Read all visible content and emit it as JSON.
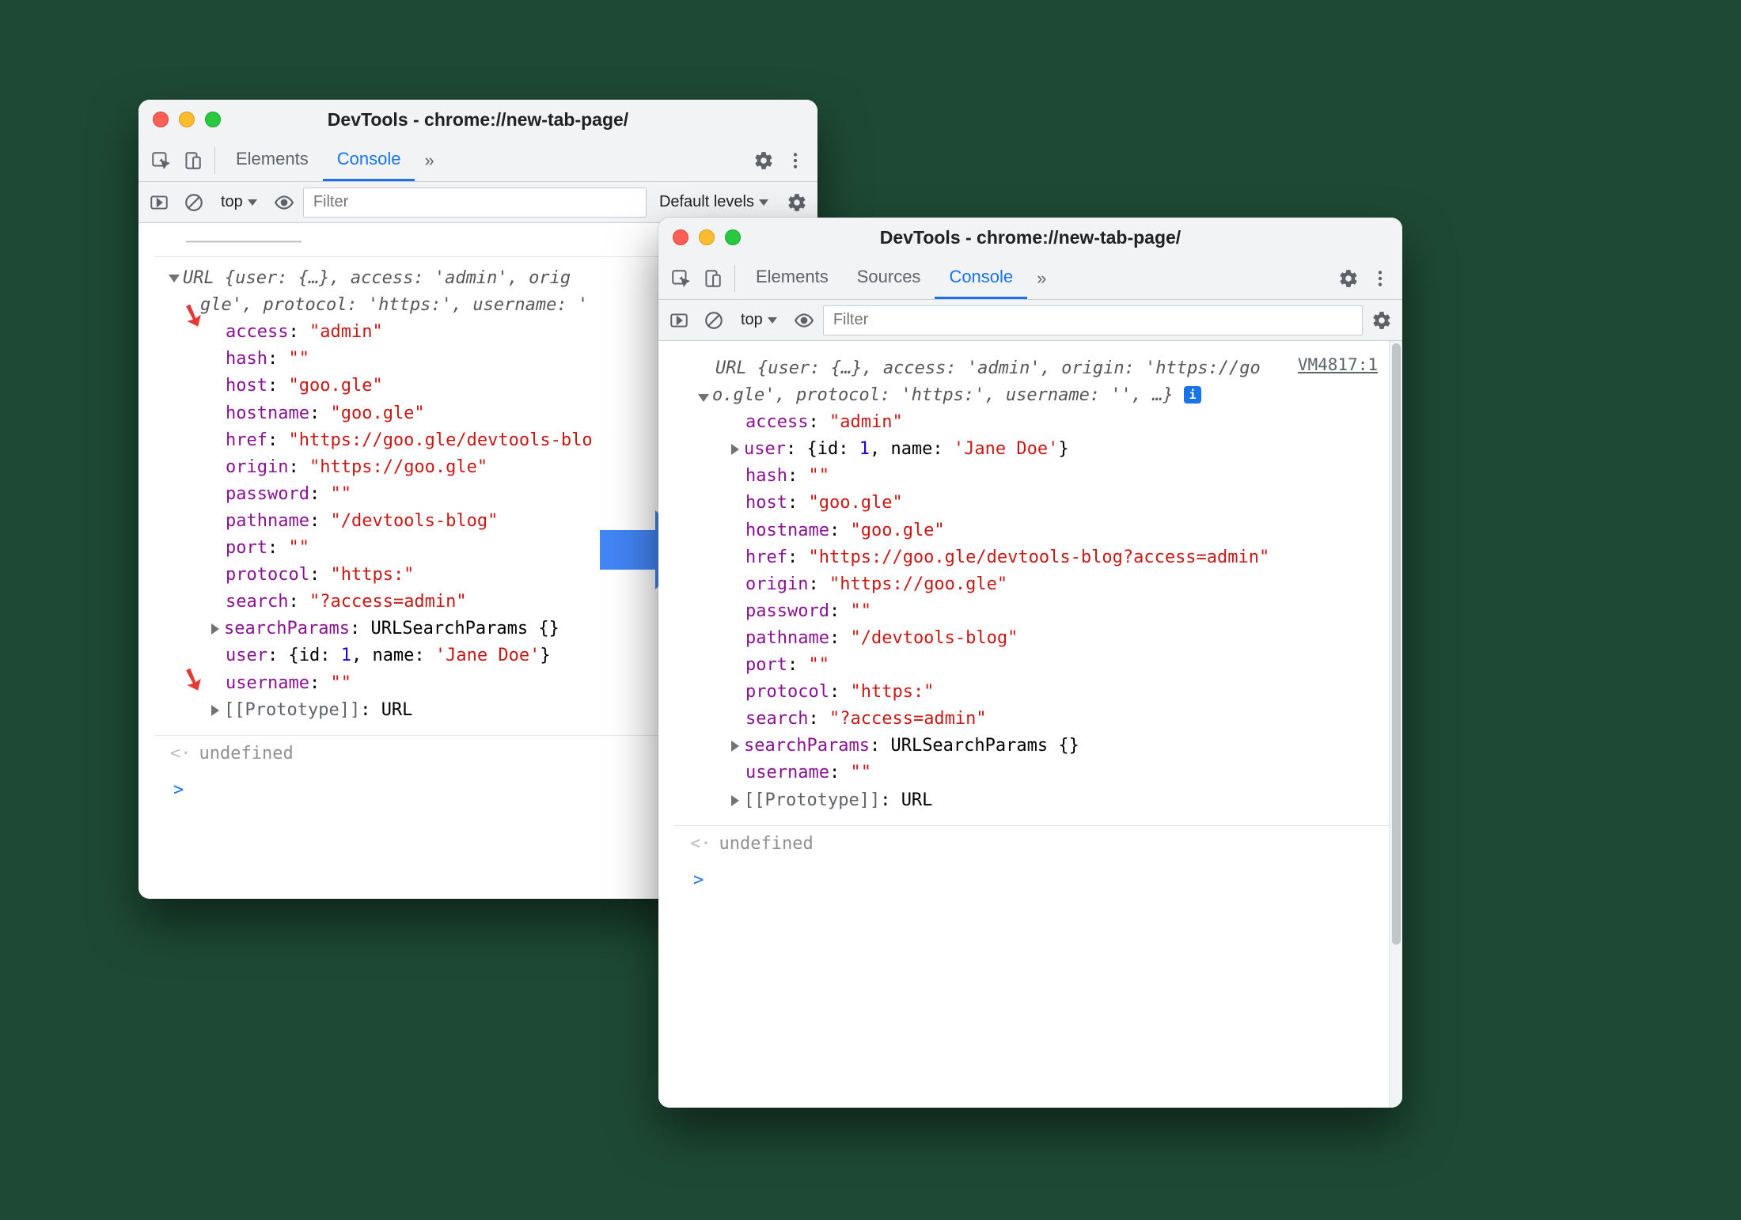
{
  "win1": {
    "title": "DevTools - chrome://new-tab-page/",
    "tabs": {
      "elements": "Elements",
      "console": "Console"
    },
    "subbar": {
      "context": "top",
      "filter_placeholder": "Filter",
      "levels": "Default levels"
    },
    "preview_line1": "URL {user: {…}, access: 'admin', orig",
    "preview_line2": "gle', protocol: 'https:', username: '",
    "props": {
      "access": {
        "k": "access",
        "v": "\"admin\""
      },
      "hash": {
        "k": "hash",
        "v": "\"\""
      },
      "host": {
        "k": "host",
        "v": "\"goo.gle\""
      },
      "hostname": {
        "k": "hostname",
        "v": "\"goo.gle\""
      },
      "href": {
        "k": "href",
        "v": "\"https://goo.gle/devtools-blo"
      },
      "origin": {
        "k": "origin",
        "v": "\"https://goo.gle\""
      },
      "password": {
        "k": "password",
        "v": "\"\""
      },
      "pathname": {
        "k": "pathname",
        "v": "\"/devtools-blog\""
      },
      "port": {
        "k": "port",
        "v": "\"\""
      },
      "protocol": {
        "k": "protocol",
        "v": "\"https:\""
      },
      "search": {
        "k": "search",
        "v": "\"?access=admin\""
      },
      "searchParams": {
        "k": "searchParams",
        "v": "URLSearchParams {}"
      },
      "user_line": "user: {id: 1, name: 'Jane Doe'}",
      "user_id": "1",
      "user_name": "'Jane Doe'",
      "username": {
        "k": "username",
        "v": "\"\""
      },
      "prototype": {
        "k": "[[Prototype]]",
        "v": "URL"
      }
    },
    "undefined": "undefined"
  },
  "win2": {
    "title": "DevTools - chrome://new-tab-page/",
    "tabs": {
      "elements": "Elements",
      "sources": "Sources",
      "console": "Console"
    },
    "subbar": {
      "context": "top",
      "filter_placeholder": "Filter"
    },
    "source": "VM4817:1",
    "preview_line1": "URL {user: {…}, access: 'admin', origin: 'https://go",
    "preview_line2": "o.gle', protocol: 'https:', username: '', …} ",
    "info_badge": "i",
    "props": {
      "access": {
        "k": "access",
        "v": "\"admin\""
      },
      "user_line": "user: {id: 1, name: 'Jane Doe'}",
      "user_id": "1",
      "user_name": "'Jane Doe'",
      "hash": {
        "k": "hash",
        "v": "\"\""
      },
      "host": {
        "k": "host",
        "v": "\"goo.gle\""
      },
      "hostname": {
        "k": "hostname",
        "v": "\"goo.gle\""
      },
      "href": {
        "k": "href",
        "v": "\"https://goo.gle/devtools-blog?access=admin\""
      },
      "origin": {
        "k": "origin",
        "v": "\"https://goo.gle\""
      },
      "password": {
        "k": "password",
        "v": "\"\""
      },
      "pathname": {
        "k": "pathname",
        "v": "\"/devtools-blog\""
      },
      "port": {
        "k": "port",
        "v": "\"\""
      },
      "protocol": {
        "k": "protocol",
        "v": "\"https:\""
      },
      "search": {
        "k": "search",
        "v": "\"?access=admin\""
      },
      "searchParams": {
        "k": "searchParams",
        "v": "URLSearchParams {}"
      },
      "username": {
        "k": "username",
        "v": "\"\""
      },
      "prototype": {
        "k": "[[Prototype]]",
        "v": "URL"
      }
    },
    "undefined": "undefined"
  }
}
